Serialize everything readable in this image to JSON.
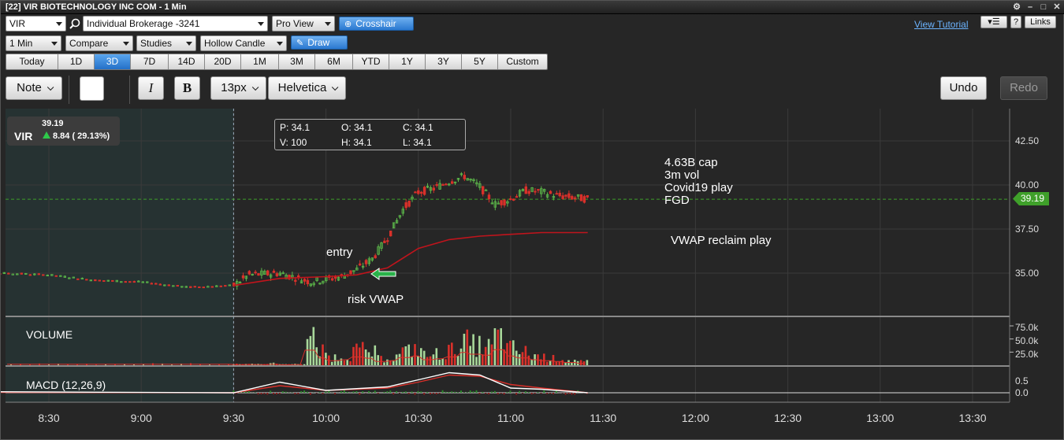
{
  "window": {
    "title": "[22] VIR BIOTECHNOLOGY INC COM - 1 Min"
  },
  "toolbar": {
    "symbol": "VIR",
    "account": "Individual Brokerage -3241",
    "view": "Pro View",
    "crosshair_label": "Crosshair",
    "view_tutorial": "View Tutorial",
    "help_label": "?",
    "links_label": "Links",
    "interval": "1 Min",
    "compare": "Compare",
    "studies": "Studies",
    "chart_style": "Hollow Candle",
    "draw_label": "Draw"
  },
  "periods": [
    "Today",
    "1D",
    "3D",
    "7D",
    "14D",
    "20D",
    "1M",
    "3M",
    "6M",
    "YTD",
    "1Y",
    "3Y",
    "5Y",
    "Custom"
  ],
  "active_period": "3D",
  "drawing_toolbar": {
    "note_label": "Note",
    "italic_label": "I",
    "bold_label": "B",
    "font_size": "13px",
    "font_family": "Helvetica",
    "undo_label": "Undo",
    "redo_label": "Redo"
  },
  "quote": {
    "symbol": "VIR",
    "last": "39.19",
    "change": "8.84 ( 29.13%)"
  },
  "ohlc": {
    "p": "P: 34.1",
    "o": "O: 34.1",
    "c": "C: 34.1",
    "v": "V: 100",
    "h": "H: 34.1",
    "l": "L: 34.1"
  },
  "annotations": {
    "stats_1": "4.63B cap",
    "stats_2": "3m vol",
    "stats_3": "Covid19 play",
    "stats_4": "FGD",
    "vwap_note": "VWAP reclaim play",
    "entry": "entry",
    "risk": "risk VWAP"
  },
  "panels": {
    "volume_label": "VOLUME",
    "macd_label": "MACD (12,26,9)"
  },
  "price_axis": [
    "42.50",
    "40.00",
    "37.50",
    "35.00"
  ],
  "volume_axis": [
    "75.0k",
    "50.0k",
    "25.0k"
  ],
  "macd_axis": [
    "0.5",
    "0.0"
  ],
  "current_price_tag": "39.19",
  "time_axis": [
    "8:30",
    "9:00",
    "9:30",
    "10:00",
    "10:30",
    "11:00",
    "11:30",
    "12:00",
    "12:30",
    "13:00",
    "13:30"
  ],
  "colors": {
    "up": "#5cb84a",
    "down": "#d9302a",
    "vwap": "#c0141c",
    "accent": "#2a78d0",
    "price_tag": "#3fa02a"
  },
  "chart_data": {
    "type": "candlestick",
    "ylim": [
      33.0,
      43.5
    ],
    "price_series": {
      "x": [
        "8:00",
        "8:15",
        "8:30",
        "8:45",
        "9:00",
        "9:15",
        "9:30",
        "9:35",
        "9:45",
        "9:55",
        "10:05",
        "10:10",
        "10:15",
        "10:20",
        "10:25",
        "10:30",
        "10:35",
        "10:40",
        "10:45",
        "10:50",
        "10:55",
        "11:00",
        "11:05",
        "11:10",
        "11:15",
        "11:20",
        "11:25"
      ],
      "values": [
        34.9,
        35.0,
        34.9,
        34.6,
        34.5,
        34.2,
        34.3,
        34.9,
        35.0,
        34.5,
        34.8,
        35.2,
        35.8,
        37.0,
        38.6,
        39.6,
        39.8,
        40.2,
        40.5,
        39.9,
        38.9,
        39.2,
        39.7,
        39.6,
        39.4,
        39.3,
        39.2
      ]
    },
    "vwap_series": {
      "x": [
        "9:30",
        "9:45",
        "10:00",
        "10:10",
        "10:20",
        "10:30",
        "10:40",
        "10:50",
        "11:00",
        "11:10",
        "11:25"
      ],
      "values": [
        34.3,
        34.7,
        34.8,
        34.9,
        35.3,
        36.4,
        36.9,
        37.1,
        37.2,
        37.3,
        37.3
      ]
    },
    "ylim_volume": [
      0,
      90000
    ],
    "volume_values_k": [
      3,
      4,
      3,
      5,
      2,
      3,
      82,
      40,
      25,
      30,
      45,
      38,
      20,
      25,
      42,
      50,
      30,
      35,
      45,
      70,
      60,
      55,
      85,
      50,
      40,
      30,
      25,
      20,
      15,
      10
    ],
    "macd_ylim": [
      -0.3,
      1.0
    ],
    "macd_line": {
      "x": [
        "8:00",
        "9:30",
        "9:45",
        "10:00",
        "10:20",
        "10:30",
        "10:40",
        "10:50",
        "11:00",
        "11:10",
        "11:25"
      ],
      "values": [
        0.05,
        0.0,
        0.45,
        0.1,
        0.25,
        0.55,
        0.85,
        0.75,
        0.2,
        0.15,
        0.0
      ]
    },
    "signal_line": {
      "x": [
        "8:00",
        "9:30",
        "9:45",
        "10:00",
        "10:20",
        "10:30",
        "10:40",
        "10:50",
        "11:00",
        "11:10",
        "11:25"
      ],
      "values": [
        0.02,
        0.0,
        0.3,
        0.1,
        0.2,
        0.45,
        0.75,
        0.7,
        0.35,
        0.2,
        0.0
      ]
    },
    "current_price": 39.19
  }
}
